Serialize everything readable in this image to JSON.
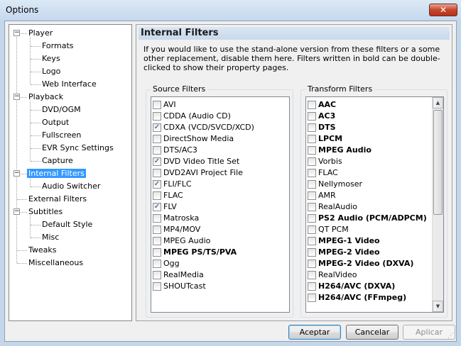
{
  "window": {
    "title": "Options",
    "close_glyph": "✕"
  },
  "tree": {
    "items": [
      {
        "label": "Player",
        "level": 0,
        "expander": "−"
      },
      {
        "label": "Formats",
        "level": 1
      },
      {
        "label": "Keys",
        "level": 1
      },
      {
        "label": "Logo",
        "level": 1
      },
      {
        "label": "Web Interface",
        "level": 1
      },
      {
        "label": "Playback",
        "level": 0,
        "expander": "−"
      },
      {
        "label": "DVD/OGM",
        "level": 1
      },
      {
        "label": "Output",
        "level": 1
      },
      {
        "label": "Fullscreen",
        "level": 1
      },
      {
        "label": "EVR Sync Settings",
        "level": 1
      },
      {
        "label": "Capture",
        "level": 1
      },
      {
        "label": "Internal Filters",
        "level": 0,
        "expander": "−",
        "selected": true
      },
      {
        "label": "Audio Switcher",
        "level": 1
      },
      {
        "label": "External Filters",
        "level": 0
      },
      {
        "label": "Subtitles",
        "level": 0,
        "expander": "−"
      },
      {
        "label": "Default Style",
        "level": 1
      },
      {
        "label": "Misc",
        "level": 1
      },
      {
        "label": "Tweaks",
        "level": 0
      },
      {
        "label": "Miscellaneous",
        "level": 0
      }
    ]
  },
  "panel": {
    "title": "Internal Filters",
    "description": "If you would like to use the stand-alone version from these filters or a some other replacement, disable them here. Filters written in bold can be double-clicked to show their property pages."
  },
  "source_filters": {
    "title": "Source Filters",
    "items": [
      {
        "label": "AVI",
        "checked": false,
        "bold": false
      },
      {
        "label": "CDDA (Audio CD)",
        "checked": false,
        "bold": false
      },
      {
        "label": "CDXA (VCD/SVCD/XCD)",
        "checked": true,
        "bold": false
      },
      {
        "label": "DirectShow Media",
        "checked": false,
        "bold": false
      },
      {
        "label": "DTS/AC3",
        "checked": false,
        "bold": false
      },
      {
        "label": "DVD Video Title Set",
        "checked": true,
        "bold": false
      },
      {
        "label": "DVD2AVI Project File",
        "checked": false,
        "bold": false
      },
      {
        "label": "FLI/FLC",
        "checked": true,
        "bold": false
      },
      {
        "label": "FLAC",
        "checked": false,
        "bold": false
      },
      {
        "label": "FLV",
        "checked": true,
        "bold": false
      },
      {
        "label": "Matroska",
        "checked": false,
        "bold": false
      },
      {
        "label": "MP4/MOV",
        "checked": false,
        "bold": false
      },
      {
        "label": "MPEG Audio",
        "checked": false,
        "bold": false
      },
      {
        "label": "MPEG PS/TS/PVA",
        "checked": false,
        "bold": true
      },
      {
        "label": "Ogg",
        "checked": false,
        "bold": false
      },
      {
        "label": "RealMedia",
        "checked": false,
        "bold": false
      },
      {
        "label": "SHOUTcast",
        "checked": false,
        "bold": false
      }
    ]
  },
  "transform_filters": {
    "title": "Transform Filters",
    "items": [
      {
        "label": "AAC",
        "checked": false,
        "bold": true
      },
      {
        "label": "AC3",
        "checked": false,
        "bold": true
      },
      {
        "label": "DTS",
        "checked": false,
        "bold": true
      },
      {
        "label": "LPCM",
        "checked": false,
        "bold": true
      },
      {
        "label": "MPEG Audio",
        "checked": false,
        "bold": true
      },
      {
        "label": "Vorbis",
        "checked": false,
        "bold": false
      },
      {
        "label": "FLAC",
        "checked": false,
        "bold": false
      },
      {
        "label": "Nellymoser",
        "checked": false,
        "bold": false
      },
      {
        "label": "AMR",
        "checked": false,
        "bold": false
      },
      {
        "label": "RealAudio",
        "checked": false,
        "bold": false
      },
      {
        "label": "PS2 Audio (PCM/ADPCM)",
        "checked": false,
        "bold": true
      },
      {
        "label": "QT PCM",
        "checked": false,
        "bold": false
      },
      {
        "label": "MPEG-1 Video",
        "checked": false,
        "bold": true
      },
      {
        "label": "MPEG-2 Video",
        "checked": false,
        "bold": true
      },
      {
        "label": "MPEG-2 Video (DXVA)",
        "checked": false,
        "bold": true
      },
      {
        "label": "RealVideo",
        "checked": false,
        "bold": false
      },
      {
        "label": "H264/AVC (DXVA)",
        "checked": false,
        "bold": true
      },
      {
        "label": "H264/AVC (FFmpeg)",
        "checked": false,
        "bold": true
      }
    ]
  },
  "buttons": {
    "ok": "Aceptar",
    "cancel": "Cancelar",
    "apply": "Aplicar"
  },
  "icons": {
    "check": "✓",
    "scroll_up": "▲",
    "scroll_down": "▼",
    "grip": "⋰"
  }
}
